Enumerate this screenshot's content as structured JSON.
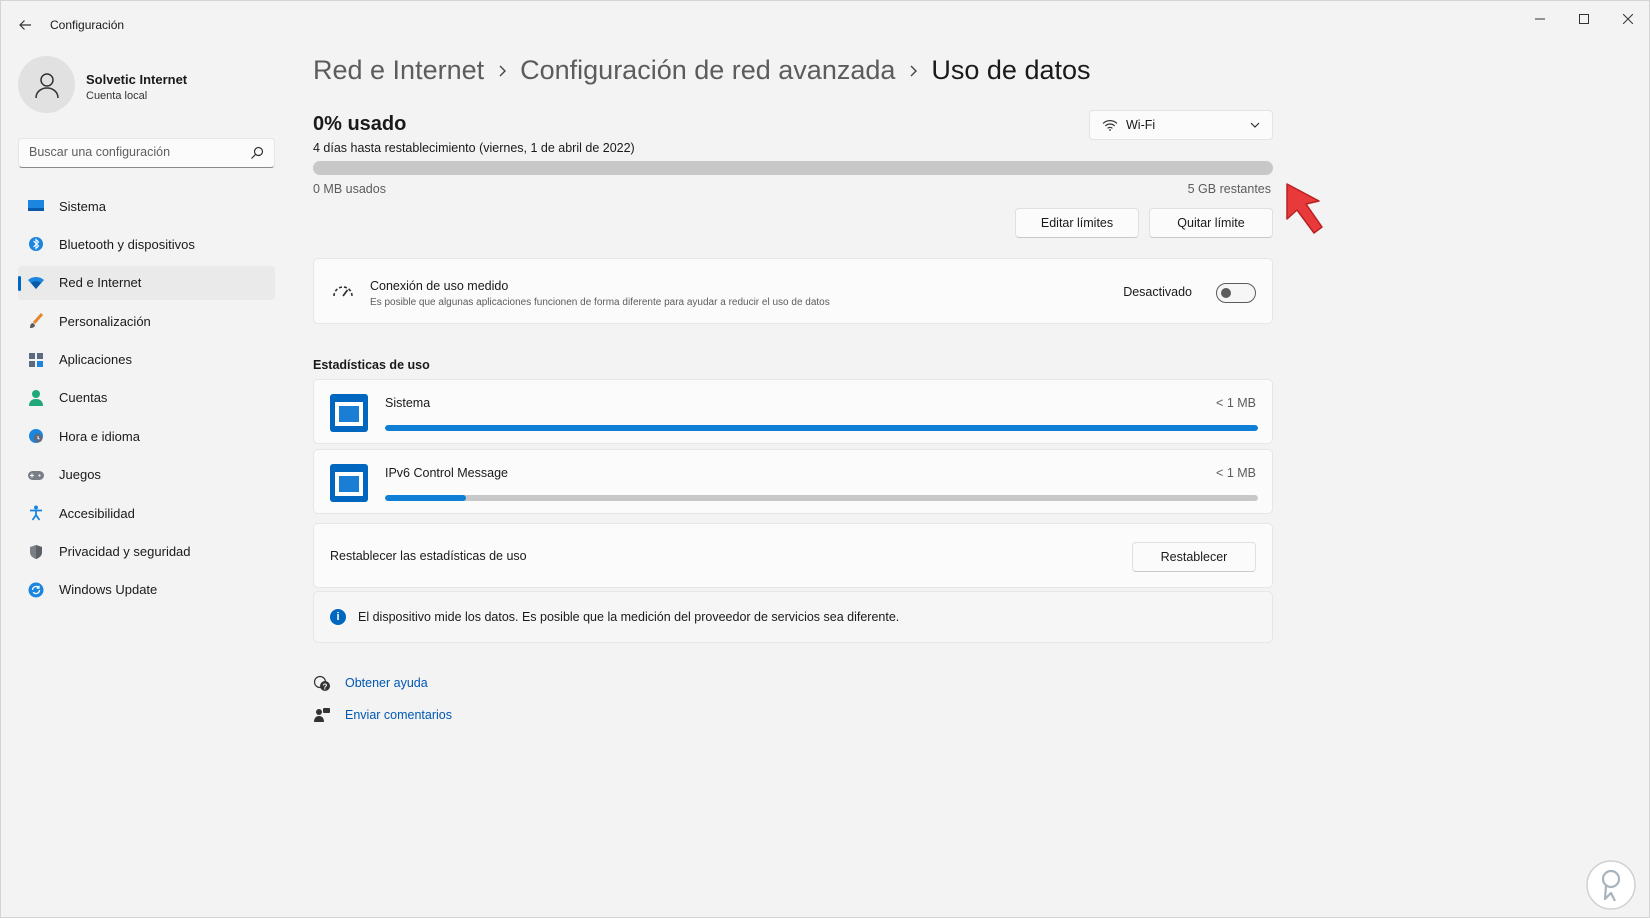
{
  "window": {
    "title": "Configuración"
  },
  "profile": {
    "name": "Solvetic Internet",
    "account": "Cuenta local"
  },
  "search": {
    "placeholder": "Buscar una configuración"
  },
  "sidebar": {
    "items": [
      {
        "label": "Sistema",
        "icon": "monitor-icon"
      },
      {
        "label": "Bluetooth y dispositivos",
        "icon": "bluetooth-icon"
      },
      {
        "label": "Red e Internet",
        "icon": "wifi-icon",
        "active": true
      },
      {
        "label": "Personalización",
        "icon": "brush-icon"
      },
      {
        "label": "Aplicaciones",
        "icon": "apps-icon"
      },
      {
        "label": "Cuentas",
        "icon": "person-icon"
      },
      {
        "label": "Hora e idioma",
        "icon": "globe-clock-icon"
      },
      {
        "label": "Juegos",
        "icon": "gamepad-icon"
      },
      {
        "label": "Accesibilidad",
        "icon": "accessibility-icon"
      },
      {
        "label": "Privacidad y seguridad",
        "icon": "shield-icon"
      },
      {
        "label": "Windows Update",
        "icon": "update-icon"
      }
    ]
  },
  "breadcrumb": {
    "items": [
      "Red e Internet",
      "Configuración de red avanzada"
    ],
    "current": "Uso de datos"
  },
  "usage": {
    "title": "0% usado",
    "reset_info": "4 días hasta restablecimiento (viernes, 1 de abril de 2022)",
    "used_fraction": 0,
    "used_label": "0 MB usados",
    "remaining_label": "5 GB restantes",
    "network": "Wi-Fi",
    "edit_limits": "Editar límites",
    "remove_limit": "Quitar límite"
  },
  "metered": {
    "title": "Conexión de uso medido",
    "description": "Es posible que algunas aplicaciones funcionen de forma diferente para ayudar a reducir el uso de datos",
    "state": "Desactivado",
    "enabled": false
  },
  "stats": {
    "heading": "Estadísticas de uso",
    "apps": [
      {
        "name": "Sistema",
        "size": "< 1 MB",
        "fraction": 1.0
      },
      {
        "name": "IPv6 Control Message",
        "size": "< 1 MB",
        "fraction": 0.093
      }
    ],
    "reset_label": "Restablecer las estadísticas de uso",
    "reset_button": "Restablecer",
    "info": "El dispositivo mide los datos. Es posible que la medición del proveedor de servicios sea diferente."
  },
  "help": {
    "get_help": "Obtener ayuda",
    "send_feedback": "Enviar comentarios"
  },
  "colors": {
    "accent": "#0067c0",
    "arrow": "#e8393b"
  }
}
